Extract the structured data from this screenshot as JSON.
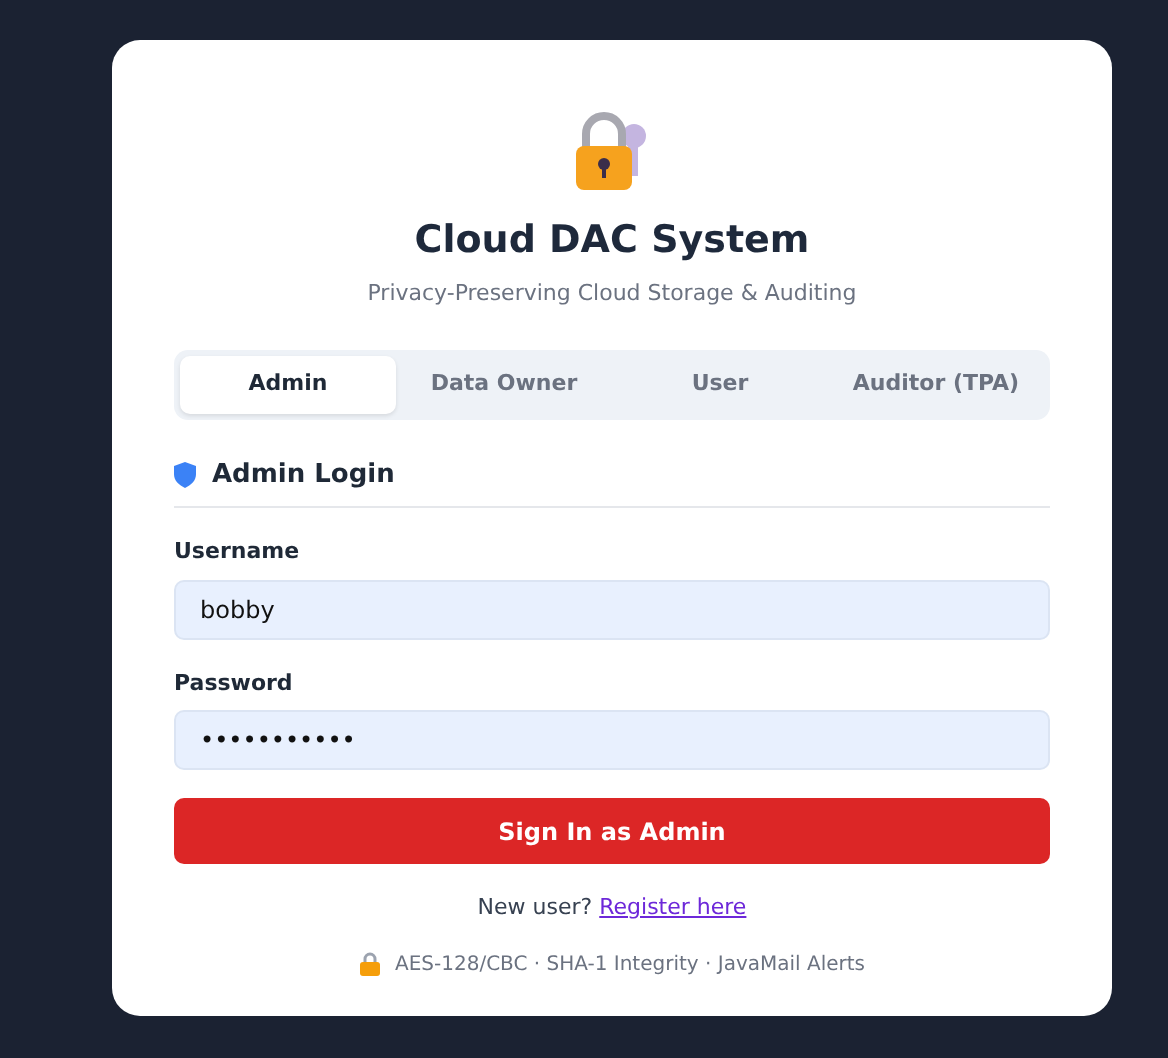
{
  "app": {
    "title": "Cloud DAC System",
    "subtitle": "Privacy-Preserving Cloud Storage & Auditing"
  },
  "tabs": [
    {
      "label": "Admin",
      "selected": true
    },
    {
      "label": "Data Owner",
      "selected": false
    },
    {
      "label": "User",
      "selected": false
    },
    {
      "label": "Auditor (TPA)",
      "selected": false
    }
  ],
  "section": {
    "title": "Admin Login"
  },
  "fields": [
    {
      "label": "Username",
      "value": "bobby"
    },
    {
      "label": "Password",
      "value": "•••••••••••"
    }
  ],
  "submit": {
    "label": "Sign In as Admin"
  },
  "register": {
    "prompt": "New user?",
    "link": "Register here"
  },
  "footer": {
    "text": "AES-128/CBC · SHA-1 Integrity · JavaMail Alerts"
  }
}
